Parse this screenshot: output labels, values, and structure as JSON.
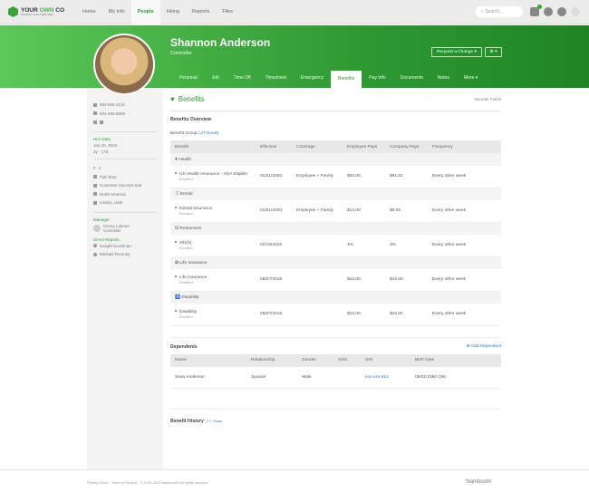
{
  "header": {
    "logo": "YOUR OWN CO",
    "logo_accent": "OWN",
    "logo_sub": "COMPANY LOGO GOES HERE",
    "nav": [
      "Home",
      "My Info",
      "People",
      "Hiring",
      "Reports",
      "Files"
    ],
    "active_nav": "People",
    "search_placeholder": "Search...",
    "inbox_badge": "9"
  },
  "profile": {
    "name": "Shannon Anderson",
    "title": "Controller",
    "request_change": "Request a Change ▾",
    "gear": "⚙ ▾",
    "tabs": [
      "Personal",
      "Job",
      "Time Off",
      "Timesheet",
      "Emergency",
      "Benefits",
      "Pay Info",
      "Documents",
      "Notes",
      "More ▾"
    ],
    "active_tab": "Benefits"
  },
  "sidebar": {
    "work_phone": "604-555-3131",
    "mobile_phone": "604-555-6808",
    "hire_date_label": "Hire Date",
    "hire_date": "Jan 20, 2018",
    "tenure": "2y - 17d",
    "employee_number": "4",
    "employment_status": "Full-Time",
    "department": "Customer Success test",
    "division": "North America",
    "location": "Lindon, Utah",
    "manager_label": "Manager",
    "manager_name": "Kenny Latimer",
    "manager_title": "Controller",
    "direct_reports_label": "Direct Reports",
    "direct_reports": [
      "Dwight Goodman",
      "Michael Romney"
    ]
  },
  "benefits": {
    "title": "Benefits",
    "reorder": "Reorder Fields",
    "overview": "Benefits Overview",
    "group_label": "Benefit Group:",
    "group_value": "UT Hourly",
    "columns": [
      "Benefit",
      "Effective",
      "Coverage",
      "Employee Pays",
      "Company Pays",
      "Frequency"
    ],
    "categories": [
      {
        "name": "Health",
        "icon": "♥",
        "plan": "US Health Insurance - HSA Eligible",
        "status": "Enrolled",
        "effective": "01/01/2020",
        "coverage": "Employee + Family",
        "employee": "$93.00",
        "company": "$91.62",
        "frequency": "Every other week"
      },
      {
        "name": "Dental",
        "icon": "♖",
        "plan": "Dental Insurance",
        "status": "Enrolled",
        "effective": "01/01/2020",
        "coverage": "Employee + Family",
        "employee": "$14.00",
        "company": "$9.08",
        "frequency": "Every other week"
      },
      {
        "name": "Retirement",
        "icon": "⛁",
        "plan": "401(k)",
        "status": "Enrolled",
        "effective": "02/19/2018",
        "coverage": "",
        "employee": "4%",
        "company": "3%",
        "frequency": "Every other week"
      },
      {
        "name": "Life Insurance",
        "icon": "✿",
        "plan": "Life Insurance",
        "status": "Enrolled",
        "effective": "05/07/2018",
        "coverage": "",
        "employee": "$10.00",
        "company": "$10.00",
        "frequency": "Every other week"
      },
      {
        "name": "Disability",
        "icon": "♿",
        "plan": "Disability",
        "status": "Enrolled",
        "effective": "05/07/2018",
        "coverage": "",
        "employee": "$10.00",
        "company": "$10.00",
        "frequency": "Every other week"
      }
    ]
  },
  "dependents": {
    "title": "Dependents",
    "add": "Add Dependent",
    "columns": [
      "Name",
      "Relationship",
      "Gender",
      "SSN",
      "SIN",
      "Birth Date"
    ],
    "rows": [
      {
        "name": "Sean Anderson",
        "relationship": "Spouse",
        "gender": "Male",
        "ssn": "",
        "sin": "xxx-xxx-514",
        "birth": "05/01/1990 (29)"
      }
    ]
  },
  "history": {
    "title": "Benefit History",
    "count": "(27)",
    "show": "Show"
  },
  "footer": {
    "links": "Privacy Policy · Terms of Service · © 2008–2020 BambooHR All rights reserved.",
    "brand": "°bamboohr"
  }
}
